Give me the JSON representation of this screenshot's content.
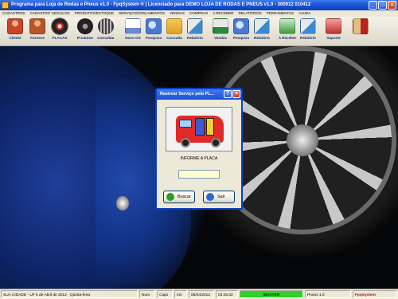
{
  "window": {
    "title": "Programa para Loja de Rodas e Pneus v1.0 - FpqSystem ® | Licenciado para DEMO LOJA DE RODAS E PNEUS v1.0 - 300912 010412"
  },
  "menu": [
    "CADASTROS",
    "CADASTRO VEICULOS",
    "PRODUTOS/ESTOQUE",
    "SERVIÇOS/ORÇAMENTOS",
    "VENDAS",
    "COMPRAS",
    "A RECEBER",
    "RELATÓRIOS",
    "FERRAMENTAS",
    "AJUDA"
  ],
  "toolbar": [
    {
      "label": "Cliente",
      "icon": "person-icon",
      "color": "#c8452a"
    },
    {
      "label": "Fornece",
      "icon": "person-icon",
      "color": "#c8452a"
    },
    {
      "label": "PLACAS",
      "icon": "tire-icon",
      "color": "#b02020"
    },
    {
      "label": "Produtos",
      "icon": "tire-icon",
      "color": "#333333"
    },
    {
      "label": "Consultar",
      "icon": "tire-icon",
      "color": "#555555"
    },
    {
      "label": "Novo OS",
      "icon": "document-icon",
      "color": "#6a8ad8"
    },
    {
      "label": "Pesquisa",
      "icon": "search-icon",
      "color": "#4a7ad0"
    },
    {
      "label": "Conculta",
      "icon": "folder-icon",
      "color": "#e0a020"
    },
    {
      "label": "Relatório",
      "icon": "report-icon",
      "color": "#3a8ad0"
    },
    {
      "label": "Vendas",
      "icon": "cart-icon",
      "color": "#2a8a3a"
    },
    {
      "label": "Pesquisa",
      "icon": "search-icon",
      "color": "#4a7ad0"
    },
    {
      "label": "Relatório",
      "icon": "report-icon",
      "color": "#3a8ad0"
    },
    {
      "label": "A Receber",
      "icon": "money-icon",
      "color": "#3a9a3a"
    },
    {
      "label": "Relatório",
      "icon": "report-icon",
      "color": "#3a8ad0"
    },
    {
      "label": "Suporte",
      "icon": "support-icon",
      "color": "#c03030"
    },
    {
      "label": "",
      "icon": "exit-icon",
      "color": "#c02020"
    }
  ],
  "dialog": {
    "title": "Rastrear Serviço pela PL...",
    "prompt": "INFORME A PLACA",
    "input_value": "",
    "buttons": {
      "search": "Buscar",
      "exit": "Sair"
    }
  },
  "statusbar": {
    "city": "SUA CIDADE - UF  5 de Abril de 2012 - Quinta-feira",
    "num": "Num",
    "caps": "Caps",
    "ins": "Ins",
    "date": "05/04/2012",
    "time": "02:45:32",
    "user": "MASTER",
    "version": "Pneus 1.0",
    "brand": "FpqSystem"
  }
}
